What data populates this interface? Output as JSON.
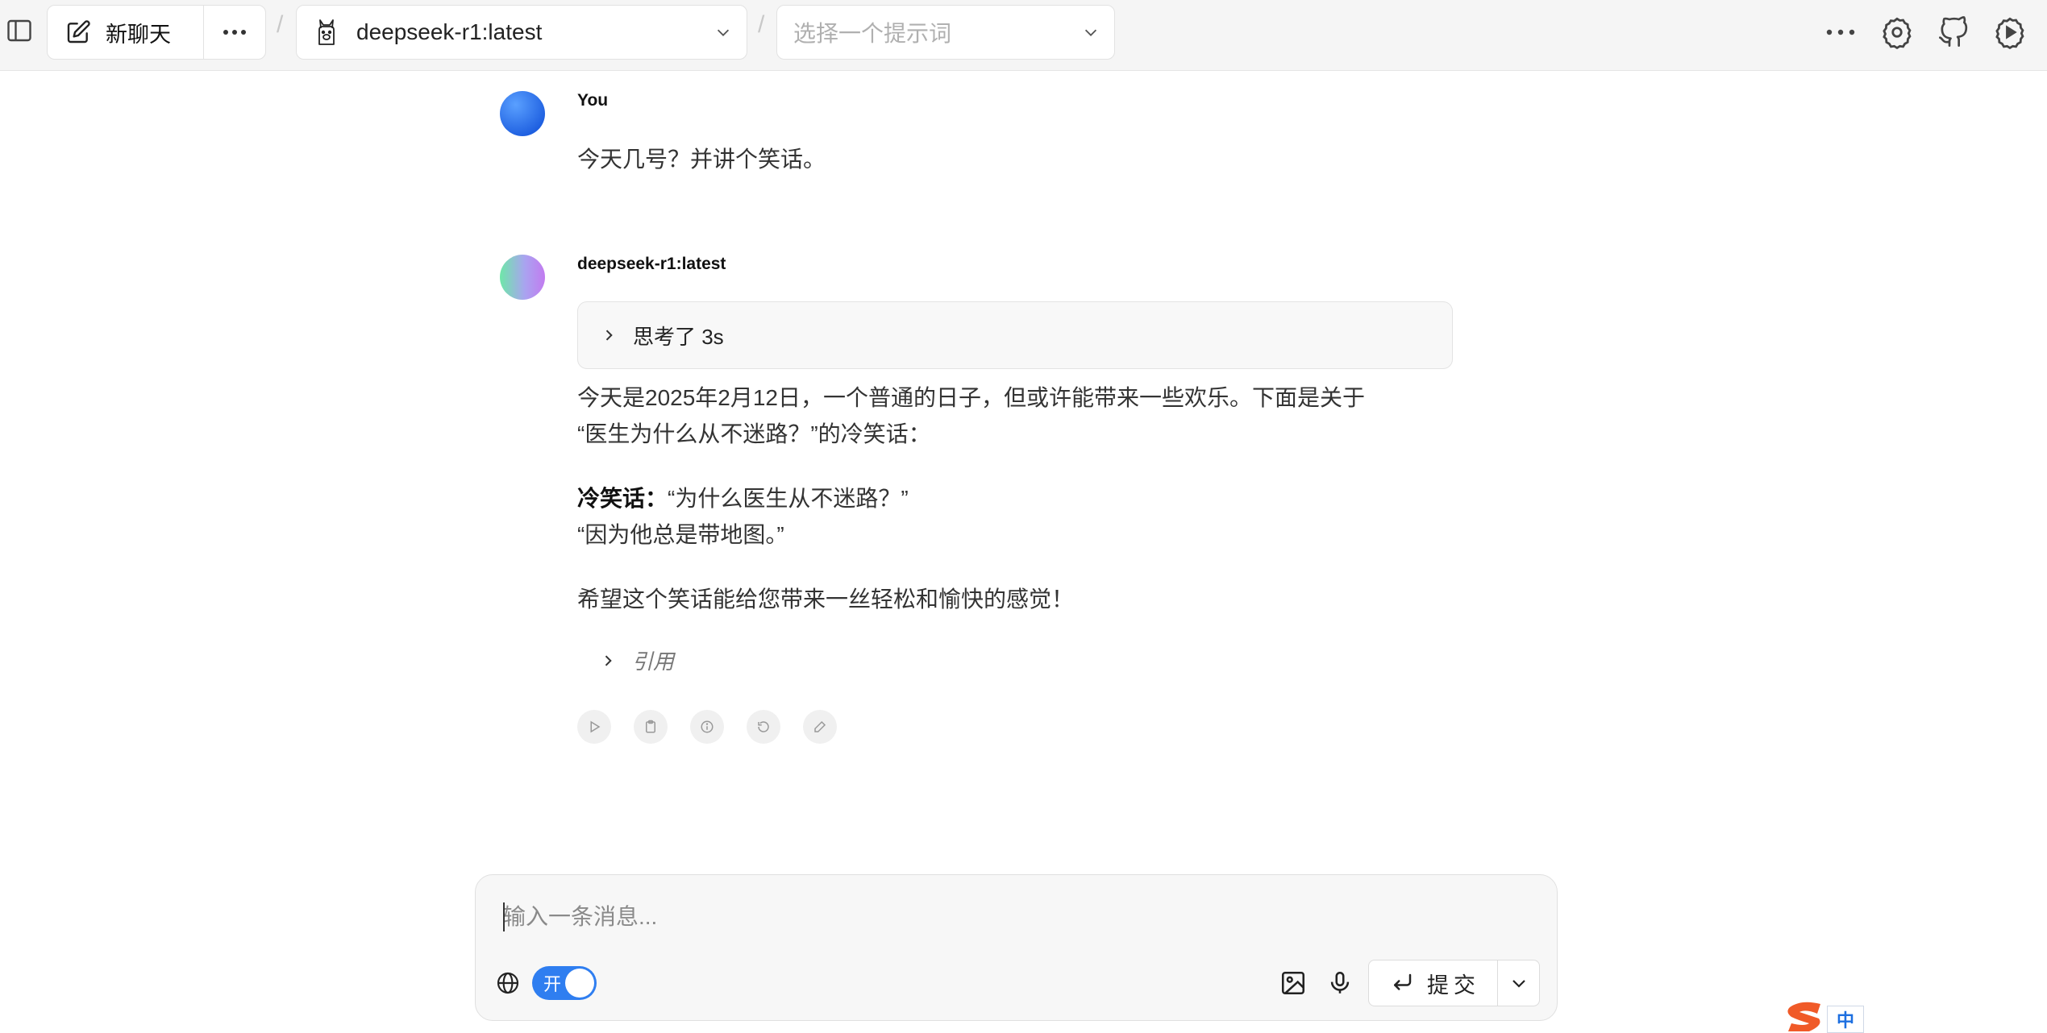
{
  "header": {
    "new_chat_label": "新聊天",
    "separator": "/",
    "model": "deepseek-r1:latest",
    "prompt_placeholder": "选择一个提示词"
  },
  "messages": {
    "user": {
      "name": "You",
      "text": "今天几号？并讲个笑话。"
    },
    "assistant": {
      "name": "deepseek-r1:latest",
      "thinking_label": "思考了 3s",
      "paragraph1_line1": "今天是2025年2月12日，一个普通的日子，但或许能带来一些欢乐。下面是关于",
      "paragraph1_line2": "“医生为什么从不迷路？”的冷笑话：",
      "joke_label": "冷笑话：",
      "joke_question": "“为什么医生从不迷路？”",
      "joke_answer": "“因为他总是带地图。”",
      "closing": "希望这个笑话能给您带来一丝轻松和愉快的感觉！",
      "citation_label": "引用"
    }
  },
  "composer": {
    "placeholder": "输入一条消息...",
    "web_search_toggle_label": "开",
    "web_search_enabled": true,
    "submit_label": "提交"
  },
  "ime": {
    "mode": "中"
  },
  "colors": {
    "accent": "#2f7ef0",
    "topbar_bg": "#f5f5f5",
    "ime_brand": "#f05a28"
  }
}
